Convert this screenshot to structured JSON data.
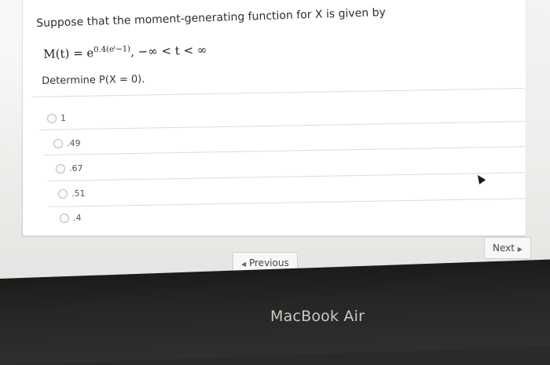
{
  "question": {
    "text": "Suppose that the moment-generating function for X is given by",
    "formula_lhs": "M(t) = e",
    "formula_exponent": "0.4(eᵗ−1)",
    "formula_rest": ", −∞ < t < ∞",
    "prompt": "Determine P(X = 0)."
  },
  "options": [
    {
      "label": "1"
    },
    {
      "label": ".49"
    },
    {
      "label": ".67"
    },
    {
      "label": ".51"
    },
    {
      "label": ".4"
    }
  ],
  "nav": {
    "previous_label": "Previous",
    "previous_icon": "triangle-left-icon",
    "next_label": "Next",
    "next_icon": "triangle-right-icon"
  },
  "device": {
    "brand": "MacBook Air"
  }
}
